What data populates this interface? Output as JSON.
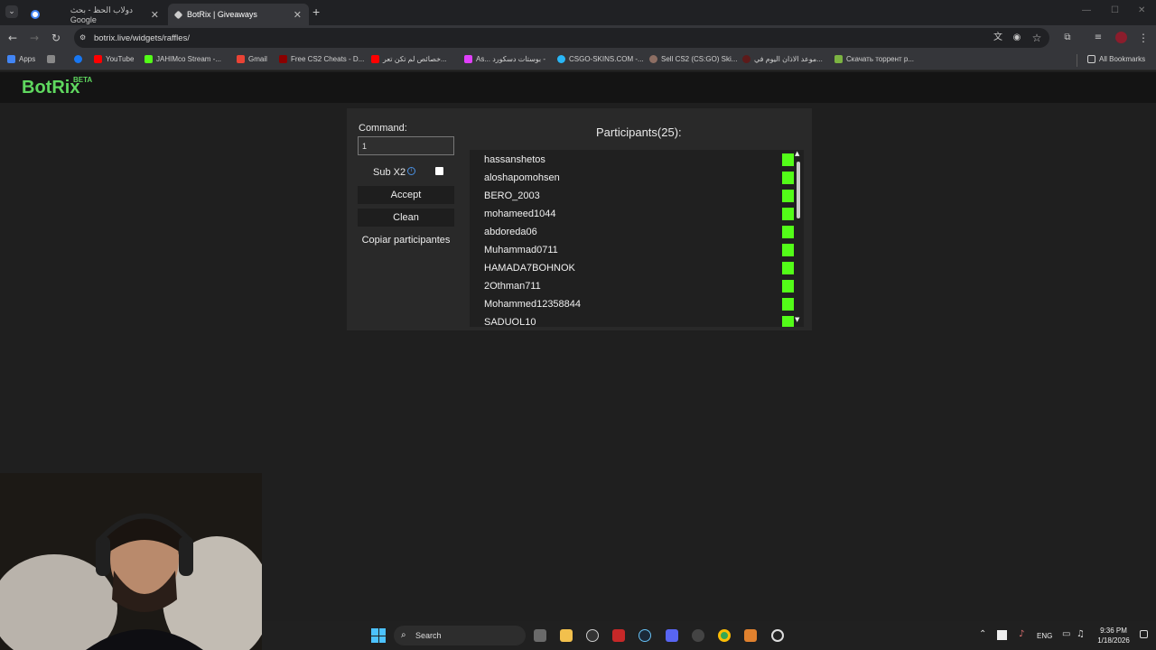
{
  "browser": {
    "tabs": [
      {
        "label": "دولاب الحظ - بحث Google",
        "active": false
      },
      {
        "label": "BotRix | Giveaways",
        "active": true
      }
    ],
    "url": "botrix.live/widgets/raffles/",
    "bookmarks": [
      {
        "label": "Apps",
        "color": "#4285f4"
      },
      {
        "label": "YouTube",
        "color": "#ff0000"
      },
      {
        "label": "JAHIMco Stream -...",
        "color": "#53fc18"
      },
      {
        "label": "Gmail",
        "color": "#ea4335"
      },
      {
        "label": "Free CS2 Cheats - D...",
        "color": "#8b0000"
      },
      {
        "label": "خصائص لم تكن تعر...",
        "color": "#ff0000"
      },
      {
        "label": "As... بوستات دسكورد -",
        "color": "#e040fb"
      },
      {
        "label": "CSGO-SKINS.COM -...",
        "color": "#29b6f6"
      },
      {
        "label": "Sell CS2 (CS:GO) Ski...",
        "color": "#8d6e63"
      },
      {
        "label": "موعد الاذان اليوم في...",
        "color": "#5d1a1a"
      },
      {
        "label": "Скачать торрент р...",
        "color": "#7cb342"
      },
      {
        "label": "All Bookmarks",
        "color": "#cfcfcf"
      }
    ]
  },
  "site": {
    "logo": "BotRix",
    "logo_badge": "BETA"
  },
  "raffle": {
    "command_label": "Command:",
    "command_value": "1",
    "sub_x2_label": "Sub X2",
    "sub_x2_info": "i",
    "accept_label": "Accept",
    "clean_label": "Clean",
    "copy_label": "Copiar participantes",
    "participants_title": "Participants(25):",
    "participants": [
      "hassanshetos",
      "aloshapomohsen",
      "BERO_2003",
      "mohameed1044",
      "abdoreda06",
      "Muhammad0711",
      "HAMADA7BOHNOK",
      "2Othman711",
      "Mohammed12358844",
      "SADUOL10"
    ],
    "kick_color": "#53fc18"
  },
  "taskbar": {
    "search_label": "Search",
    "lang": "ENG",
    "time": "9:36 PM",
    "date": "1/18/2026"
  }
}
